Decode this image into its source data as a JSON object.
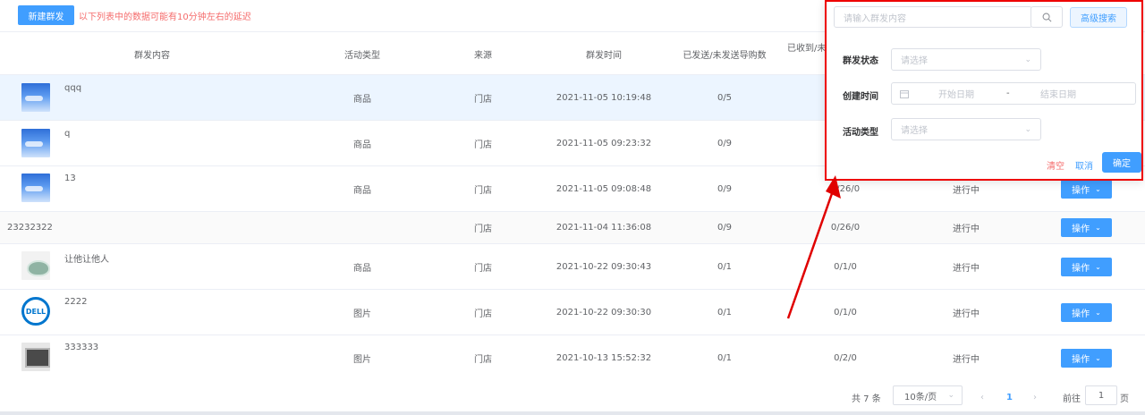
{
  "toolbar": {
    "new_button": "新建群发",
    "notice": "以下列表中的数据可能有10分钟左右的延迟"
  },
  "columns": {
    "content": "群发内容",
    "activity_type": "活动类型",
    "source": "来源",
    "time": "群发时间",
    "sent": "已发送/未发送导购数",
    "received": "已收到/未"
  },
  "rows": [
    {
      "title": "qqq",
      "thumb": "sky-image",
      "type": "商品",
      "source": "门店",
      "time": "2021-11-05 10:19:48",
      "sent": "0/5",
      "received": "",
      "status": "",
      "op": ""
    },
    {
      "title": "q",
      "thumb": "sky-image",
      "type": "商品",
      "source": "门店",
      "time": "2021-11-05 09:23:32",
      "sent": "0/9",
      "received": "",
      "status": "",
      "op": ""
    },
    {
      "title": "13",
      "thumb": "sky-image",
      "type": "商品",
      "source": "门店",
      "time": "2021-11-05 09:08:48",
      "sent": "0/9",
      "received": "0/26/0",
      "status": "进行中",
      "op": "操作"
    },
    {
      "title": "23232322",
      "thumb": "",
      "type": "",
      "source": "门店",
      "time": "2021-11-04 11:36:08",
      "sent": "0/9",
      "received": "0/26/0",
      "status": "进行中",
      "op": "操作"
    },
    {
      "title": "让他让他人",
      "thumb": "bowl-image",
      "type": "商品",
      "source": "门店",
      "time": "2021-10-22 09:30:43",
      "sent": "0/1",
      "received": "0/1/0",
      "status": "进行中",
      "op": "操作"
    },
    {
      "title": "2222",
      "thumb": "dell-logo",
      "thumb_text": "DELL",
      "type": "图片",
      "source": "门店",
      "time": "2021-10-22 09:30:30",
      "sent": "0/1",
      "received": "0/1/0",
      "status": "进行中",
      "op": "操作"
    },
    {
      "title": "333333",
      "thumb": "laptop-image",
      "type": "图片",
      "source": "门店",
      "time": "2021-10-13 15:52:32",
      "sent": "0/1",
      "received": "0/2/0",
      "status": "进行中",
      "op": "操作"
    }
  ],
  "pagination": {
    "total": "共 7 条",
    "page_size": "10条/页",
    "current": "1",
    "goto_label": "前往",
    "goto_value": "1",
    "page_suffix": "页"
  },
  "filter": {
    "search_placeholder": "请输入群发内容",
    "advanced_button": "高级搜索",
    "status_label": "群发状态",
    "status_placeholder": "请选择",
    "created_label": "创建时间",
    "start_placeholder": "开始日期",
    "range_sep": "-",
    "end_placeholder": "结束日期",
    "activity_label": "活动类型",
    "activity_placeholder": "请选择",
    "clear": "清空",
    "cancel": "取消",
    "confirm": "确定"
  },
  "colors": {
    "primary": "#409eff",
    "danger": "#f56c6c",
    "annotation": "#e00000"
  }
}
